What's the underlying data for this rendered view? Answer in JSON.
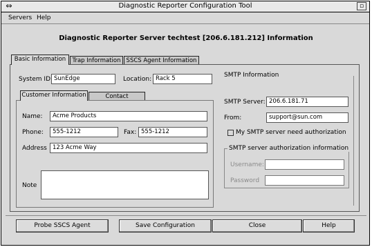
{
  "window": {
    "title": "Diagnostic Reporter Configuration Tool",
    "system_icon": "⇔",
    "corner_icon": "▫"
  },
  "menubar": {
    "items": [
      "Servers",
      "Help"
    ]
  },
  "heading": "Diagnostic Reporter Server techtest  [206.6.181.212]  Information",
  "main_tabs": [
    "Basic Information",
    "Trap Information",
    "SSCS Agent Information"
  ],
  "basic": {
    "system_id_label": "System ID:",
    "system_id_value": "SunEdge",
    "location_label": "Location:",
    "location_value": "Rack 5"
  },
  "sub_tabs": [
    "Customer Information",
    "Contact Information"
  ],
  "customer": {
    "name_label": "Name:",
    "name_value": "Acme Products",
    "phone_label": "Phone:",
    "phone_value": "555-1212",
    "fax_label": "Fax:",
    "fax_value": "555-1212",
    "address_label": "Address",
    "address_value": "123 Acme Way",
    "note_label": "Note",
    "note_value": ""
  },
  "smtp": {
    "section_title": "SMTP Information",
    "server_label": "SMTP Server:",
    "server_value": "206.6.181.71",
    "from_label": "From:",
    "from_value": "support@sun.com",
    "auth_checkbox_label": "My SMTP server need authorization",
    "auth_checked": false,
    "auth_group_title": "SMTP server authorization information",
    "username_label": "Username:",
    "username_value": "",
    "password_label": "Password",
    "password_value": ""
  },
  "buttons": {
    "probe": "Probe SSCS Agent",
    "save": "Save Configuration",
    "close": "Close",
    "help": "Help"
  }
}
